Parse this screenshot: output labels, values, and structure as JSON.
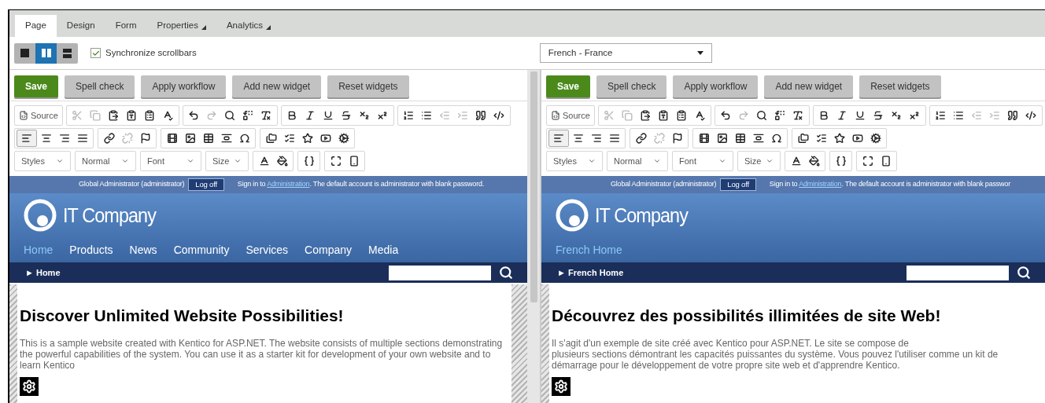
{
  "tabs": [
    {
      "label": "Page",
      "selected": true,
      "dropdown": false
    },
    {
      "label": "Design",
      "selected": false,
      "dropdown": false
    },
    {
      "label": "Form",
      "selected": false,
      "dropdown": false
    },
    {
      "label": "Properties",
      "selected": false,
      "dropdown": true
    },
    {
      "label": "Analytics",
      "selected": false,
      "dropdown": true
    }
  ],
  "view_modes": [
    {
      "kind": "single",
      "selected": false
    },
    {
      "kind": "vertical",
      "selected": true
    },
    {
      "kind": "horizontal",
      "selected": false
    }
  ],
  "sync_scrollbars": {
    "label": "Synchronize scrollbars",
    "checked": true
  },
  "language_select": {
    "value": "French - France"
  },
  "panes": [
    {
      "buttons": [
        {
          "label": "Save",
          "kind": "primary"
        },
        {
          "label": "Spell check",
          "kind": "secondary"
        },
        {
          "label": "Apply workflow",
          "kind": "secondary"
        },
        {
          "label": "Add new widget",
          "kind": "secondary"
        },
        {
          "label": "Reset widgets",
          "kind": "secondary"
        }
      ],
      "source_label": "Source",
      "format_dropdowns": [
        "Styles",
        "Normal",
        "Font",
        "Size"
      ],
      "site": {
        "user": "Global Administrator (administrator)",
        "logoff": "Log off",
        "signin_before": "Sign in to ",
        "signin_link": "Administration",
        "signin_after": ". The default account is administrator with blank password.",
        "logo": "IT Company",
        "nav": [
          {
            "label": "Home",
            "selected": true
          },
          {
            "label": "Products",
            "selected": false
          },
          {
            "label": "News",
            "selected": false
          },
          {
            "label": "Community",
            "selected": false
          },
          {
            "label": "Services",
            "selected": false
          },
          {
            "label": "Company",
            "selected": false
          },
          {
            "label": "Media",
            "selected": false
          }
        ],
        "breadcrumb": "Home",
        "breadcrumb_marker": "►",
        "heading": "Discover Unlimited Website Possibilities!",
        "paragraph": "This is a sample website created with Kentico for ASP.NET. The website consists of multiple sections demonstrating the powerful capabilities of the system. You can use it as a starter kit for development of your own website and to learn Kentico"
      }
    },
    {
      "buttons": [
        {
          "label": "Save",
          "kind": "primary"
        },
        {
          "label": "Spell check",
          "kind": "secondary"
        },
        {
          "label": "Apply workflow",
          "kind": "secondary"
        },
        {
          "label": "Add new widget",
          "kind": "secondary"
        },
        {
          "label": "Reset widgets",
          "kind": "secondary"
        }
      ],
      "source_label": "Source",
      "format_dropdowns": [
        "Styles",
        "Normal",
        "Font",
        "Size"
      ],
      "site": {
        "user": "Global Administrator (administrator)",
        "logoff": "Log off",
        "signin_before": "Sign in to ",
        "signin_link": "Administration",
        "signin_after": ". The default account is administrator with blank passwor",
        "logo": "IT Company",
        "nav": [
          {
            "label": "French Home",
            "selected": true
          }
        ],
        "breadcrumb": "French Home",
        "breadcrumb_marker": "►",
        "heading": "Découvrez des possibilités illimitées de site Web!",
        "paragraph": "Il s'agit d'un exemple de site créé avec Kentico pour ASP.NET. Le site se compose de\nplusieurs sections démontrant les capacités puissantes du système. Vous pouvez l'utiliser comme un kit de démarrage pour le développement de votre propre site web et d'apprendre Kentico."
      }
    }
  ]
}
